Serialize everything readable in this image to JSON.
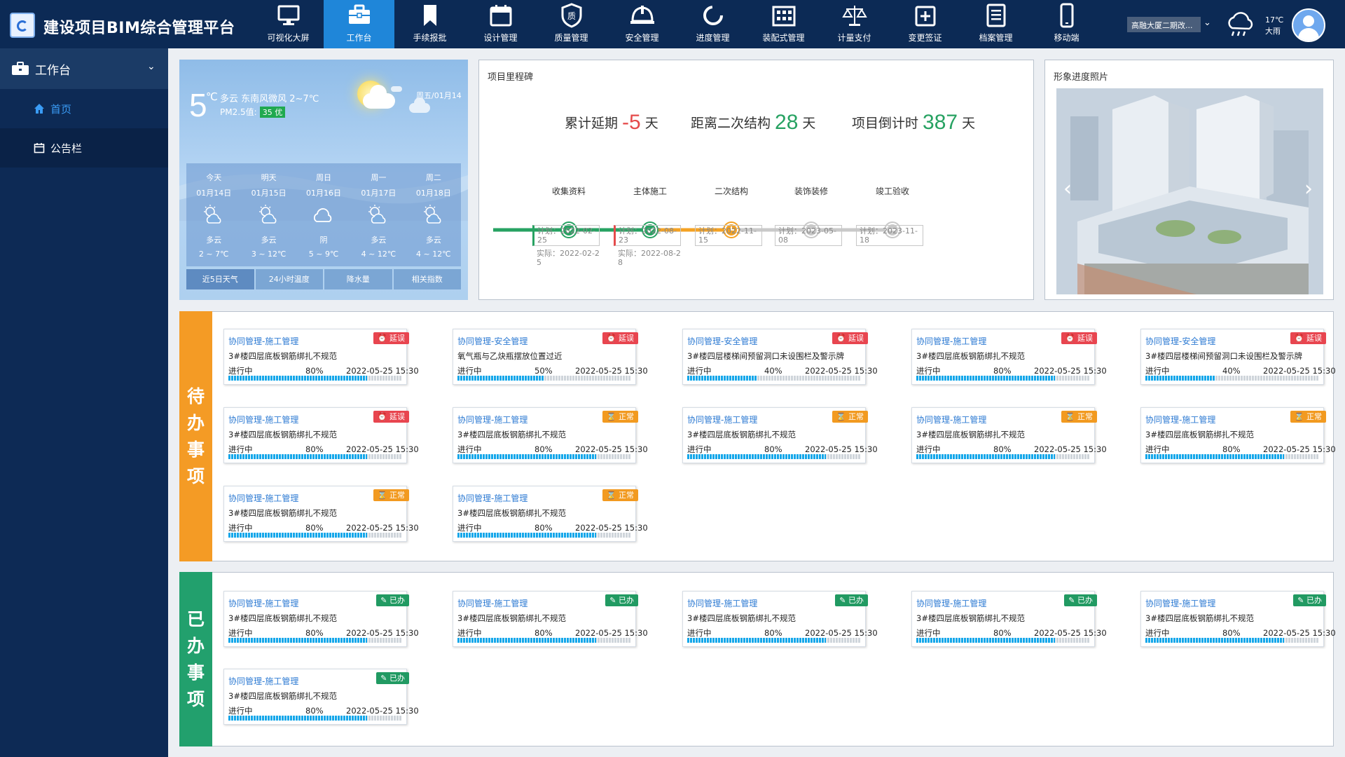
{
  "header": {
    "title": "建设项目BIM综合管理平台",
    "nav": [
      {
        "label": "可视化大屏",
        "icon": "monitor-icon"
      },
      {
        "label": "工作台",
        "icon": "briefcase-icon",
        "active": true
      },
      {
        "label": "手续报批",
        "icon": "bookmark-icon"
      },
      {
        "label": "设计管理",
        "icon": "calendar-icon"
      },
      {
        "label": "质量管理",
        "icon": "quality-shield-icon"
      },
      {
        "label": "安全管理",
        "icon": "helmet-icon"
      },
      {
        "label": "进度管理",
        "icon": "progress-ring-icon"
      },
      {
        "label": "装配式管理",
        "icon": "building-icon"
      },
      {
        "label": "计量支付",
        "icon": "scale-icon"
      },
      {
        "label": "变更签证",
        "icon": "calendar-plus-icon"
      },
      {
        "label": "档案管理",
        "icon": "list-document-icon"
      },
      {
        "label": "移动端",
        "icon": "mobile-icon"
      }
    ],
    "project_select": "高融大厦二期改...",
    "weather_temp": "17℃",
    "weather_text": "大雨"
  },
  "sidebar": {
    "group": "工作台",
    "items": [
      {
        "label": "首页",
        "active": true
      },
      {
        "label": "公告栏",
        "active": false
      }
    ]
  },
  "weather": {
    "temp": "5",
    "unit": "℃",
    "desc": "多云 东南风微风 2~7℃",
    "pm_label": "PM2.5值:",
    "aqi": "35 优",
    "date": "周五/01月14日",
    "forecast": [
      {
        "day": "今天",
        "date": "01月14日",
        "cond": "多云",
        "range": "2 ~ 7℃",
        "icon": "partly-cloudy-icon"
      },
      {
        "day": "明天",
        "date": "01月15日",
        "cond": "多云",
        "range": "3 ~ 12℃",
        "icon": "partly-cloudy-icon"
      },
      {
        "day": "周日",
        "date": "01月16日",
        "cond": "阴",
        "range": "5 ~ 9℃",
        "icon": "cloudy-icon"
      },
      {
        "day": "周一",
        "date": "01月17日",
        "cond": "多云",
        "range": "4 ~ 12℃",
        "icon": "partly-cloudy-icon"
      },
      {
        "day": "周二",
        "date": "01月18日",
        "cond": "多云",
        "range": "4 ~ 12℃",
        "icon": "partly-cloudy-icon"
      }
    ],
    "tabs": [
      "近5日天气",
      "24小时温度",
      "降水量",
      "相关指数"
    ]
  },
  "milestone": {
    "title": "项目里程碑",
    "stat1_label": "累计延期",
    "stat1_value": "-5",
    "stat1_unit": "天",
    "stat2_label": "距离二次结构",
    "stat2_value": "28",
    "stat2_unit": "天",
    "stat3_label": "项目倒计时",
    "stat3_value": "387",
    "stat3_unit": "天",
    "stages": [
      {
        "name": "收集资料",
        "status": "done",
        "plan": "计划：2022-02-25",
        "actual": "实际：2022-02-25"
      },
      {
        "name": "主体施工",
        "status": "done",
        "plan": "计划：2022-08-23",
        "actual": "实际：2022-08-28"
      },
      {
        "name": "二次结构",
        "status": "current",
        "plan": "计划：2022-11-15",
        "actual": ""
      },
      {
        "name": "装饰装修",
        "status": "pending",
        "plan": "计划：2023-05-08",
        "actual": ""
      },
      {
        "name": "竣工验收",
        "status": "pending",
        "plan": "计划：2023-11-18",
        "actual": ""
      }
    ],
    "colors": {
      "done": "#27a262",
      "current": "#f4a224",
      "pending": "#c9c9c9"
    }
  },
  "photo": {
    "title": "形象进度照片"
  },
  "todo": {
    "band": "待办事项",
    "cards": [
      {
        "cat": "协同管理-施工管理",
        "badge": "延误",
        "type": "late",
        "title": "3#楼四层底板钢筋绑扎不规范",
        "status": "进行中",
        "progress": 80,
        "pct": "80%",
        "time": "2022-05-25  15:30"
      },
      {
        "cat": "协同管理-安全管理",
        "badge": "延误",
        "type": "late",
        "title": "氧气瓶与乙炔瓶摆放位置过近",
        "status": "进行中",
        "progress": 50,
        "pct": "50%",
        "time": "2022-05-25  15:30"
      },
      {
        "cat": "协同管理-安全管理",
        "badge": "延误",
        "type": "late",
        "title": "3#楼四层楼梯间预留洞口未设围栏及警示牌",
        "status": "进行中",
        "progress": 40,
        "pct": "40%",
        "time": "2022-05-25  15:30"
      },
      {
        "cat": "协同管理-施工管理",
        "badge": "延误",
        "type": "late",
        "title": "3#楼四层底板钢筋绑扎不规范",
        "status": "进行中",
        "progress": 80,
        "pct": "80%",
        "time": "2022-05-25  15:30"
      },
      {
        "cat": "协同管理-安全管理",
        "badge": "延误",
        "type": "late",
        "title": "3#楼四层楼梯间预留洞口未设围栏及警示牌",
        "status": "进行中",
        "progress": 40,
        "pct": "40%",
        "time": "2022-05-25  15:30"
      },
      {
        "cat": "协同管理-施工管理",
        "badge": "延误",
        "type": "late",
        "title": "3#楼四层底板钢筋绑扎不规范",
        "status": "进行中",
        "progress": 80,
        "pct": "80%",
        "time": "2022-05-25  15:30"
      },
      {
        "cat": "协同管理-施工管理",
        "badge": "正常",
        "type": "normal",
        "title": "3#楼四层底板钢筋绑扎不规范",
        "status": "进行中",
        "progress": 80,
        "pct": "80%",
        "time": "2022-05-25  15:30"
      },
      {
        "cat": "协同管理-施工管理",
        "badge": "正常",
        "type": "normal",
        "title": "3#楼四层底板钢筋绑扎不规范",
        "status": "进行中",
        "progress": 80,
        "pct": "80%",
        "time": "2022-05-25  15:30"
      },
      {
        "cat": "协同管理-施工管理",
        "badge": "正常",
        "type": "normal",
        "title": "3#楼四层底板钢筋绑扎不规范",
        "status": "进行中",
        "progress": 80,
        "pct": "80%",
        "time": "2022-05-25  15:30"
      },
      {
        "cat": "协同管理-施工管理",
        "badge": "正常",
        "type": "normal",
        "title": "3#楼四层底板钢筋绑扎不规范",
        "status": "进行中",
        "progress": 80,
        "pct": "80%",
        "time": "2022-05-25  15:30"
      },
      {
        "cat": "协同管理-施工管理",
        "badge": "正常",
        "type": "normal",
        "title": "3#楼四层底板钢筋绑扎不规范",
        "status": "进行中",
        "progress": 80,
        "pct": "80%",
        "time": "2022-05-25  15:30"
      },
      {
        "cat": "协同管理-施工管理",
        "badge": "正常",
        "type": "normal",
        "title": "3#楼四层底板钢筋绑扎不规范",
        "status": "进行中",
        "progress": 80,
        "pct": "80%",
        "time": "2022-05-25  15:30"
      }
    ]
  },
  "done": {
    "band": "已办事项",
    "cards": [
      {
        "cat": "协同管理-施工管理",
        "badge": "已办",
        "type": "doneb",
        "title": "3#楼四层底板钢筋绑扎不规范",
        "status": "进行中",
        "progress": 80,
        "pct": "80%",
        "time": "2022-05-25  15:30"
      },
      {
        "cat": "协同管理-施工管理",
        "badge": "已办",
        "type": "doneb",
        "title": "3#楼四层底板钢筋绑扎不规范",
        "status": "进行中",
        "progress": 80,
        "pct": "80%",
        "time": "2022-05-25  15:30"
      },
      {
        "cat": "协同管理-施工管理",
        "badge": "已办",
        "type": "doneb",
        "title": "3#楼四层底板钢筋绑扎不规范",
        "status": "进行中",
        "progress": 80,
        "pct": "80%",
        "time": "2022-05-25  15:30"
      },
      {
        "cat": "协同管理-施工管理",
        "badge": "已办",
        "type": "doneb",
        "title": "3#楼四层底板钢筋绑扎不规范",
        "status": "进行中",
        "progress": 80,
        "pct": "80%",
        "time": "2022-05-25  15:30"
      },
      {
        "cat": "协同管理-施工管理",
        "badge": "已办",
        "type": "doneb",
        "title": "3#楼四层底板钢筋绑扎不规范",
        "status": "进行中",
        "progress": 80,
        "pct": "80%",
        "time": "2022-05-25  15:30"
      },
      {
        "cat": "协同管理-施工管理",
        "badge": "已办",
        "type": "doneb",
        "title": "3#楼四层底板钢筋绑扎不规范",
        "status": "进行中",
        "progress": 80,
        "pct": "80%",
        "time": "2022-05-25  15:30"
      }
    ]
  }
}
